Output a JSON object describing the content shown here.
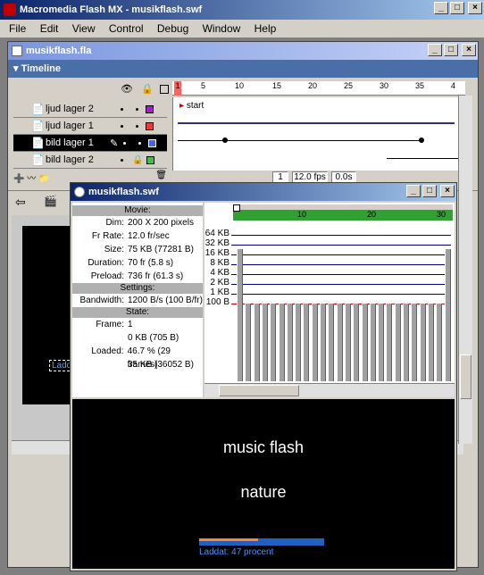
{
  "app": {
    "title": "Macromedia Flash MX - musikflash.swf",
    "menu": [
      "File",
      "Edit",
      "View",
      "Control",
      "Debug",
      "Window",
      "Help"
    ]
  },
  "doc_window": {
    "title": "musikflash.fla",
    "timeline_label": "Timeline",
    "frame_ruler": [
      "1",
      "5",
      "10",
      "15",
      "20",
      "25",
      "30",
      "35",
      "4"
    ],
    "layers": [
      {
        "name": "ljud lager 2",
        "color": "#a020c0",
        "selected": false
      },
      {
        "name": "ljud lager 1",
        "color": "#e04040",
        "selected": false
      },
      {
        "name": "bild lager 1",
        "color": "#4060ff",
        "selected": true
      },
      {
        "name": "bild lager 2",
        "color": "#40c040",
        "selected": false
      }
    ],
    "frame_label": "start",
    "status": {
      "frame": "1",
      "fps": "12.0 fps",
      "time": "0.0s"
    }
  },
  "swf_window": {
    "title": "musikflash.swf",
    "movie_header": "Movie:",
    "movie": [
      {
        "k": "Dim:",
        "v": "200 X 200 pixels"
      },
      {
        "k": "Fr Rate:",
        "v": "12.0 fr/sec"
      },
      {
        "k": "Size:",
        "v": "75 KB (77281 B)"
      },
      {
        "k": "Duration:",
        "v": "70 fr (5.8 s)"
      },
      {
        "k": "Preload:",
        "v": "736 fr (61.3 s)"
      }
    ],
    "settings_header": "Settings:",
    "settings": [
      {
        "k": "Bandwidth:",
        "v": "1200 B/s (100 B/fr)"
      }
    ],
    "state_header": "State:",
    "state": [
      {
        "k": "Frame:",
        "v": "1"
      },
      {
        "k": "",
        "v": "0 KB (705 B)"
      },
      {
        "k": "Loaded:",
        "v": "46.7 % (29 frames)"
      },
      {
        "k": "",
        "v": "35 KB (36052 B)"
      }
    ],
    "graph_ruler": [
      "10",
      "20",
      "30"
    ],
    "graph_labels": [
      "64 KB",
      "32 KB",
      "16 KB",
      "8 KB",
      "4 KB",
      "2 KB",
      "1 KB",
      "100 B"
    ],
    "stage": {
      "line1": "music flash",
      "line2": "nature",
      "loader_text": "Laddat: 47 procent",
      "progress": 0.47
    }
  },
  "behind": {
    "loader_text": "Ladd"
  }
}
